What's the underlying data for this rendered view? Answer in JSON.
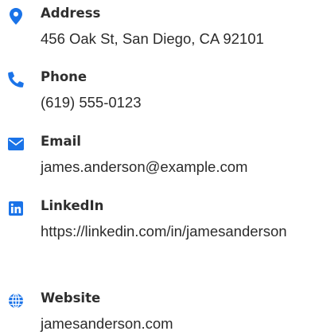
{
  "accent_color": "#1a73e8",
  "contact": {
    "items": [
      {
        "id": "address",
        "icon": "map-marker-icon",
        "label": "Address",
        "value": "456 Oak St, San Diego, CA 92101"
      },
      {
        "id": "phone",
        "icon": "phone-icon",
        "label": "Phone",
        "value": "(619) 555-0123"
      },
      {
        "id": "email",
        "icon": "envelope-icon",
        "label": "Email",
        "value": "james.anderson@example.com"
      },
      {
        "id": "linkedin",
        "icon": "linkedin-icon",
        "label": "LinkedIn",
        "value": "https://linkedin.com/in/jamesanderson"
      },
      {
        "id": "website",
        "icon": "globe-icon",
        "label": "Website",
        "value": "jamesanderson.com"
      }
    ]
  }
}
